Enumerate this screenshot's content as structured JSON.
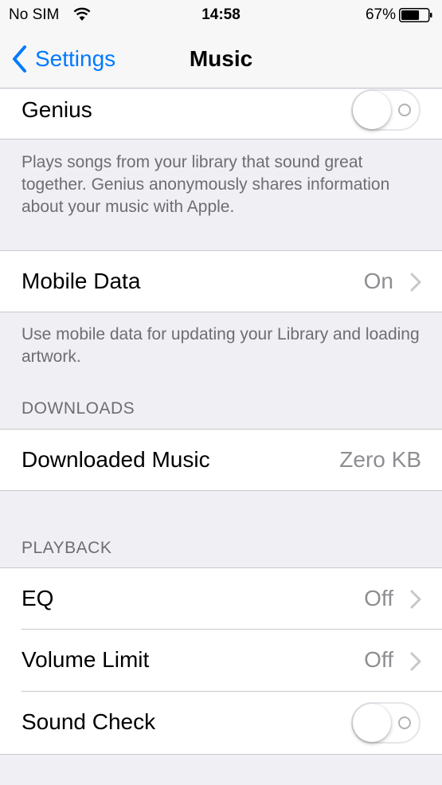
{
  "status_bar": {
    "carrier": "No SIM",
    "time": "14:58",
    "battery_percent": "67%",
    "battery_level": 0.67,
    "wifi_icon": "wifi-icon",
    "battery_icon": "battery-icon"
  },
  "nav": {
    "back_label": "Settings",
    "title": "Music",
    "accent_color": "#007aff"
  },
  "genius": {
    "label": "Genius",
    "toggle_on": false,
    "footer": "Plays songs from your library that sound great together. Genius anonymously shares information about your music with Apple."
  },
  "mobile_data": {
    "label": "Mobile Data",
    "value": "On",
    "footer": "Use mobile data for updating your Library and loading artwork."
  },
  "downloads": {
    "header": "DOWNLOADS",
    "downloaded_music_label": "Downloaded Music",
    "downloaded_music_value": "Zero KB"
  },
  "playback": {
    "header": "PLAYBACK",
    "eq_label": "EQ",
    "eq_value": "Off",
    "volume_limit_label": "Volume Limit",
    "volume_limit_value": "Off",
    "sound_check_label": "Sound Check",
    "sound_check_on": false
  }
}
